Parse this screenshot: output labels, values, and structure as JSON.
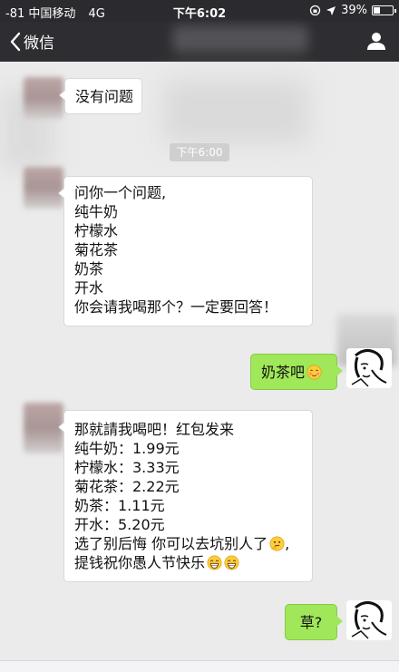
{
  "status_bar": {
    "signal": "-81",
    "carrier": "中国移动",
    "network": "4G",
    "time": "下午6:02",
    "battery_percent": "39%",
    "battery_level": 0.39
  },
  "nav": {
    "back_label": "微信"
  },
  "messages": {
    "m1": [
      "没有问题"
    ],
    "timestamp": "下午6:00",
    "m2": [
      "问你一个问题,",
      "纯牛奶",
      "柠檬水",
      "菊花茶",
      "奶茶",
      "开水",
      "你会请我喝那个？一定要回答！"
    ],
    "m3": "奶茶吧",
    "m4": [
      "那就請我喝吧！红包发来",
      "纯牛奶：1.99元",
      "柠檬水：3.33元",
      "菊花茶：2.22元",
      "奶茶：1.11元",
      "开水：5.20元",
      "选了别后悔 你可以去坑别人了",
      "提钱祝你愚人节快乐"
    ],
    "m5": "草?"
  },
  "icons": {
    "back": "chevron-left-icon",
    "profile": "person-icon",
    "emoji_m3": "blushing-face-icon",
    "emoji_m4_line7": "thinking-face-icon",
    "emoji_m4_line8": "grinning-face-icon"
  },
  "colors": {
    "chat_bg": "#ebebeb",
    "nav_bg": "#2e2e32",
    "sent_bubble": "#a0e759",
    "received_bubble": "#ffffff"
  }
}
